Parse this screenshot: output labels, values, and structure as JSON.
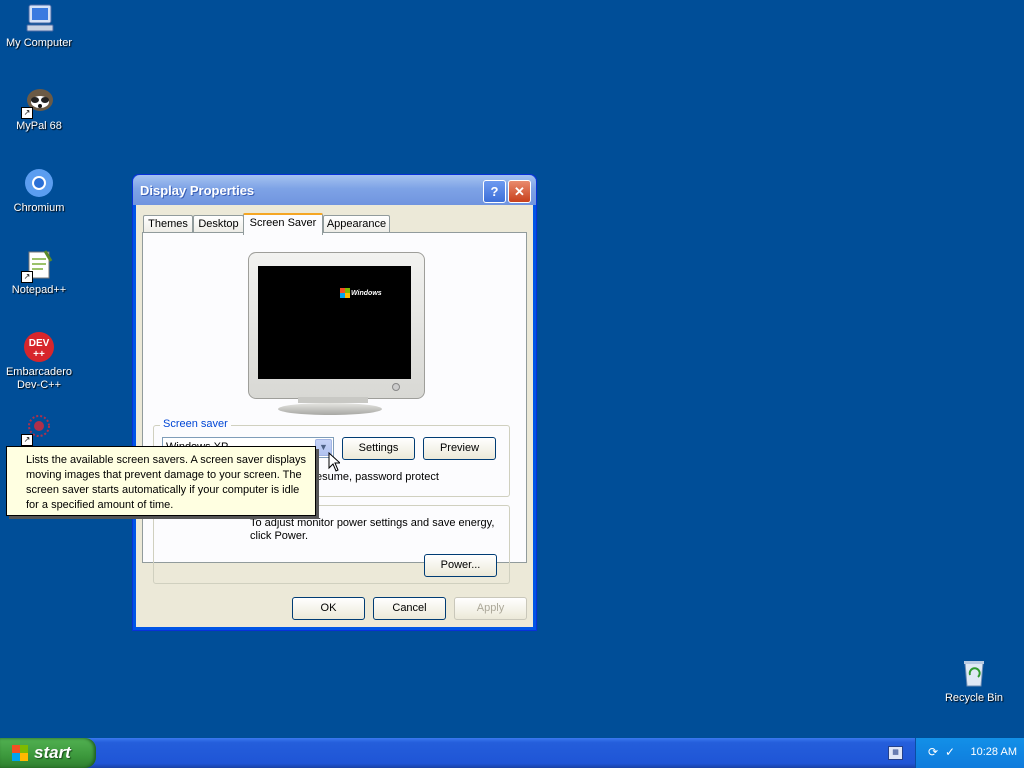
{
  "desktop": {
    "icons": [
      {
        "label": "My Computer",
        "icon": "my-computer-icon"
      },
      {
        "label": "MyPal 68",
        "icon": "mypal-icon"
      },
      {
        "label": "Chromium",
        "icon": "chromium-icon"
      },
      {
        "label": "Notepad++",
        "icon": "notepad-plus-plus-icon"
      },
      {
        "label": "Embarcadero Dev-C++",
        "icon": "dev-cpp-icon"
      },
      {
        "label": "Recycle Bin",
        "icon": "recycle-bin-icon"
      }
    ],
    "devcpp_logo_text": "DEV\n++"
  },
  "window": {
    "title": "Display Properties",
    "help_glyph": "?",
    "close_glyph": "✕",
    "tabs": [
      "Themes",
      "Desktop",
      "Screen Saver",
      "Appearance"
    ],
    "active_tab": "Screen Saver",
    "preview_logo": "Windows"
  },
  "screen_saver": {
    "group_label": "Screen saver",
    "selected": "Windows XP",
    "settings_label": "Settings",
    "preview_label": "Preview",
    "resume_text": "esume, password protect"
  },
  "power": {
    "text": "To adjust monitor power settings and save energy, click Power.",
    "button_label": "Power..."
  },
  "footer": {
    "ok_label": "OK",
    "cancel_label": "Cancel",
    "apply_label": "Apply"
  },
  "tooltip": {
    "text": "Lists the available screen savers. A screen saver displays moving images that prevent damage to your screen. The screen saver starts automatically if your computer is idle for a specified amount of time."
  },
  "taskbar": {
    "start_label": "start",
    "clock": "10:28 AM",
    "colors": {
      "desktop": "#004e98",
      "start": "#3c983c",
      "tray": "#0f7bdc"
    }
  }
}
